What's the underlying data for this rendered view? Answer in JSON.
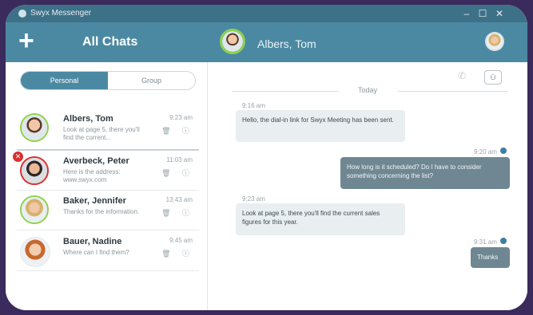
{
  "titlebar": {
    "title": "Swyx Messenger",
    "minimize": "–",
    "maximize": "☐",
    "close": "✕"
  },
  "header": {
    "add_label": "+",
    "title": "All Chats",
    "contact_name": "Albers, Tom"
  },
  "toggle": {
    "personal": "Personal",
    "group": "Group"
  },
  "chats": [
    {
      "name": "Albers, Tom",
      "preview": "Look at page 5, there you'll find the current...",
      "time": "9:23 am",
      "icons": "🗑 ⓘ",
      "face": "male"
    },
    {
      "name": "Averbeck, Peter",
      "preview": "Here is the address: www.swyx.com",
      "time": "11:03 am",
      "icons": "🗑 ⓘ",
      "face": "male2",
      "badge": "✕"
    },
    {
      "name": "Baker, Jennifer",
      "preview": "Thanks for the information.",
      "time": "13:43 am",
      "icons": "🗑 ⓘ",
      "face": "blond"
    },
    {
      "name": "Bauer, Nadine",
      "preview": "Where can I find them?",
      "time": "9:45 am",
      "icons": "🗑 ⓘ",
      "face": "female"
    }
  ],
  "conversation": {
    "day": "Today",
    "messages": [
      {
        "dir": "in",
        "time": "9:16 am",
        "text": "Hello, the dial-in link for Swyx Meeting has been sent."
      },
      {
        "dir": "out",
        "time": "9:20 am",
        "text": "How long is it scheduled? Do I have to consider something concerning the list?"
      },
      {
        "dir": "in",
        "time": "9:23 am",
        "text": "Look at page 5, there you'll find the current sales figures for this year."
      },
      {
        "dir": "out",
        "time": "9:31 am",
        "text": "Thanks"
      }
    ]
  },
  "icons": {
    "app": "swyx-logo-icon",
    "phone": "phone-icon",
    "contact": "contact-card-icon"
  }
}
